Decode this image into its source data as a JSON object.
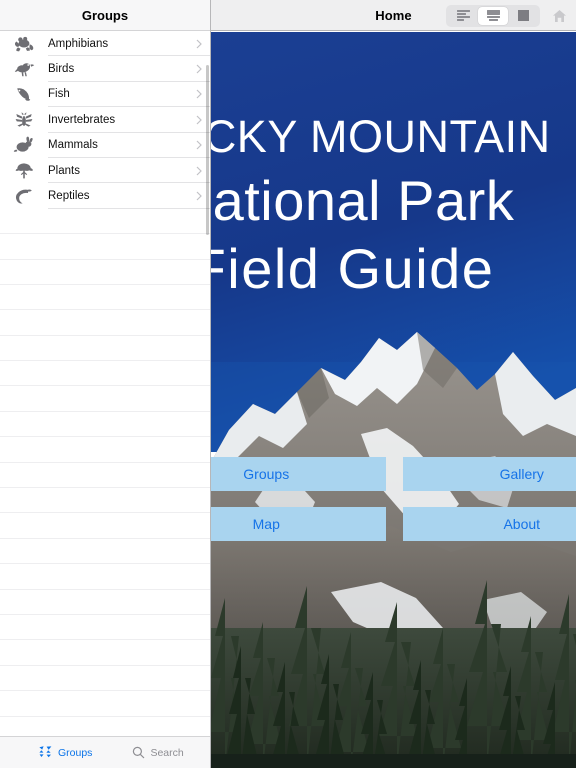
{
  "app": {
    "main_title": "Home",
    "sidebar_title": "Groups"
  },
  "toolbar": {
    "segment_options": [
      "list-view",
      "split-view",
      "full-view"
    ],
    "selected_segment": "split-view",
    "home_icon": "home-icon"
  },
  "hero": {
    "title_line1": "ROCKY MOUNTAIN",
    "title_line2": "National Park",
    "title_line3": "Field Guide",
    "buttons": [
      {
        "label": "Groups"
      },
      {
        "label": "Gallery"
      },
      {
        "label": "Map"
      },
      {
        "label": "About"
      }
    ],
    "colors": {
      "sky": "#163a8c",
      "button_bg": "#a9d4ef",
      "button_text": "#1673e8"
    }
  },
  "sidebar": {
    "items": [
      {
        "label": "Amphibians",
        "icon": "frog-icon"
      },
      {
        "label": "Birds",
        "icon": "bird-icon"
      },
      {
        "label": "Fish",
        "icon": "fish-icon"
      },
      {
        "label": "Invertebrates",
        "icon": "insect-icon"
      },
      {
        "label": "Mammals",
        "icon": "rabbit-icon"
      },
      {
        "label": "Plants",
        "icon": "tree-icon"
      },
      {
        "label": "Reptiles",
        "icon": "lizard-icon"
      }
    ],
    "toolbar": {
      "groups_label": "Groups",
      "search_label": "Search",
      "groups_icon": "groups-icon",
      "search_icon": "search-icon",
      "active": "Groups"
    }
  }
}
